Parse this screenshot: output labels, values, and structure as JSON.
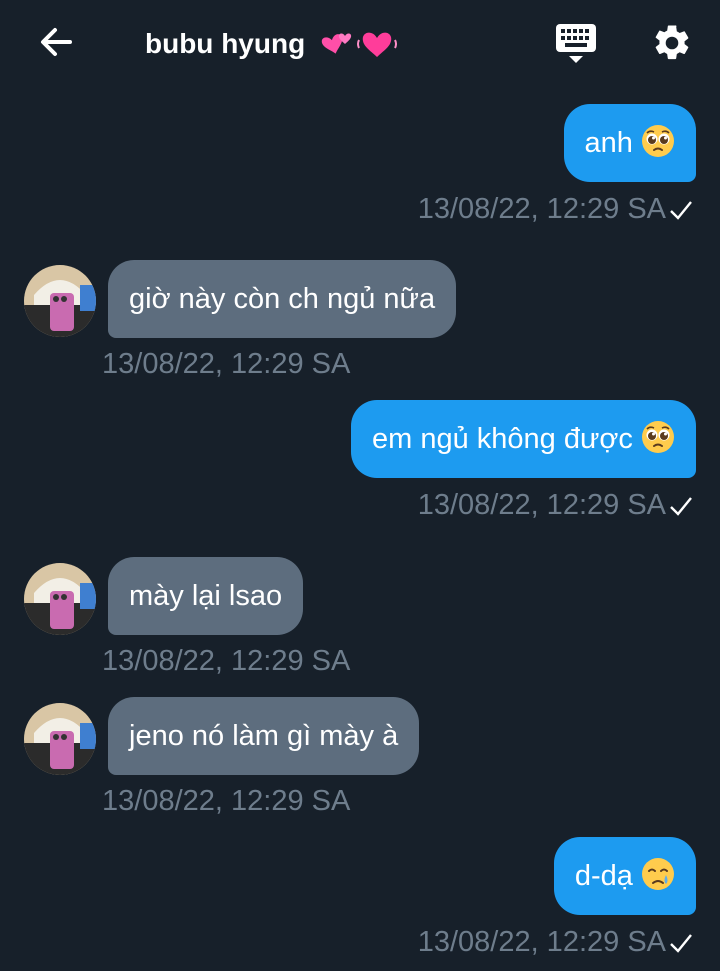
{
  "header": {
    "title": "bubu hyung",
    "title_emoji": "💕💓",
    "back_icon": "arrow-left-icon",
    "keyboard_icon": "keyboard-icon",
    "settings_icon": "gear-icon"
  },
  "messages": [
    {
      "direction": "outgoing",
      "text": "anh ",
      "emoji": "pleading-face",
      "timestamp": "13/08/22, 12:29 SA",
      "status": "sent"
    },
    {
      "direction": "incoming",
      "text": "giờ này còn ch ngủ nữa",
      "timestamp": "13/08/22, 12:29 SA"
    },
    {
      "direction": "outgoing",
      "text": "em ngủ không được ",
      "emoji": "pleading-face",
      "timestamp": "13/08/22, 12:29 SA",
      "status": "sent"
    },
    {
      "direction": "incoming",
      "text": "mày lại lsao",
      "timestamp": "13/08/22, 12:29 SA"
    },
    {
      "direction": "incoming",
      "text": "jeno nó làm gì mày à",
      "timestamp": "13/08/22, 12:29 SA"
    },
    {
      "direction": "outgoing",
      "text": "d-dạ ",
      "emoji": "crying-face",
      "timestamp": "13/08/22, 12:29 SA",
      "status": "sent"
    }
  ],
  "colors": {
    "background": "#17202a",
    "outgoing_bubble": "#1d9bf0",
    "incoming_bubble": "#5d6d7e",
    "timestamp": "#6e7d8c"
  }
}
